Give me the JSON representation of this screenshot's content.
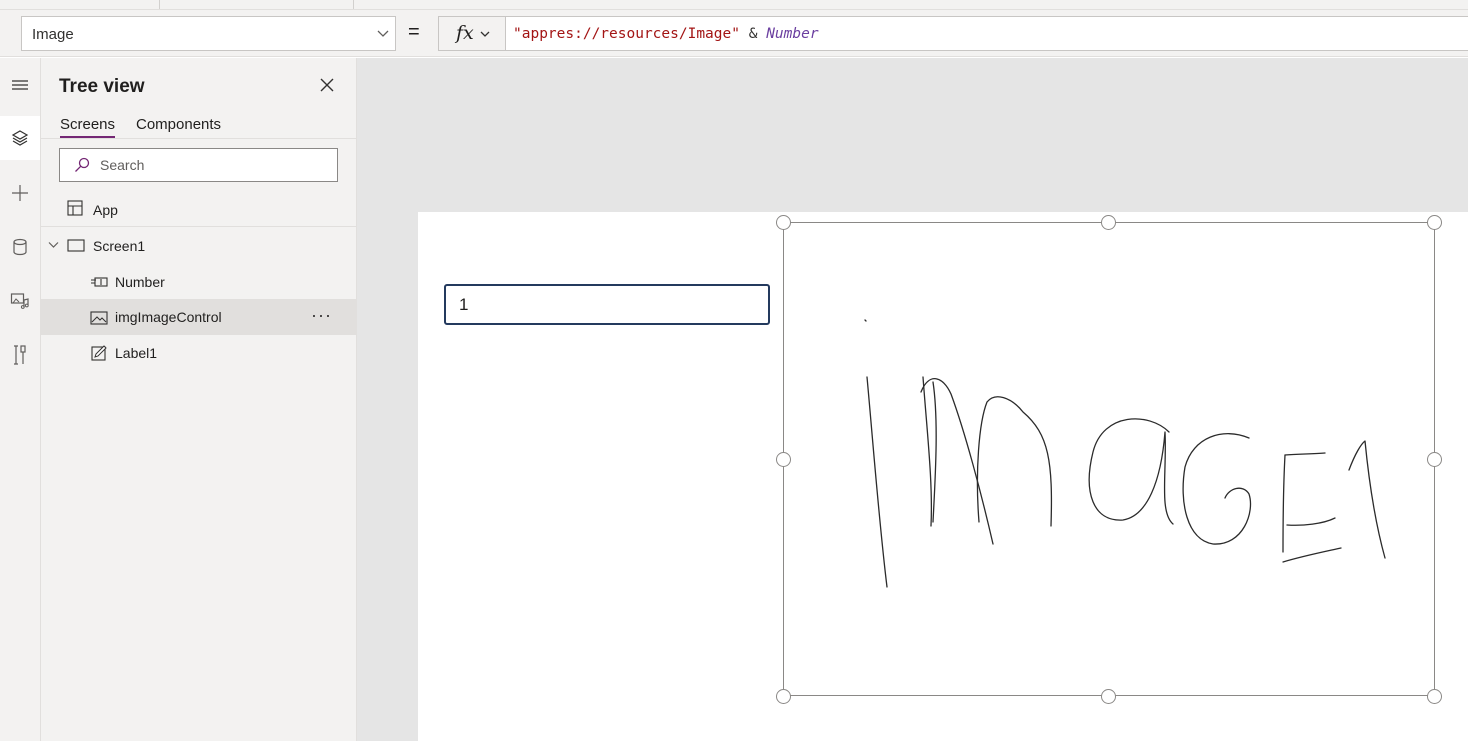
{
  "formula_bar": {
    "property": "Image",
    "equals": "=",
    "fx_label": "fx",
    "formula_string": "\"appres://resources/Image\"",
    "formula_operator": " & ",
    "formula_variable": "Number"
  },
  "rail": {
    "items": [
      "hamburger-icon",
      "layers-icon",
      "plus-icon",
      "database-icon",
      "media-icon",
      "tools-icon"
    ],
    "active": "layers-icon"
  },
  "tree_view": {
    "title": "Tree view",
    "tabs": [
      {
        "label": "Screens",
        "active": true
      },
      {
        "label": "Components",
        "active": false
      }
    ],
    "search_placeholder": "Search",
    "app_label": "App",
    "screen_label": "Screen1",
    "children": [
      {
        "label": "Number",
        "icon": "text-input-icon",
        "selected": false
      },
      {
        "label": "imgImageControl",
        "icon": "image-icon",
        "selected": true
      },
      {
        "label": "Label1",
        "icon": "label-edit-icon",
        "selected": false
      }
    ],
    "more_label": "···"
  },
  "canvas": {
    "number_input_value": "1",
    "image_control_content": "IMAGE1"
  },
  "colors": {
    "accent": "#742774",
    "input_border": "#243a5e",
    "string_token": "#a31515",
    "variable_token": "#6b3fa0"
  }
}
